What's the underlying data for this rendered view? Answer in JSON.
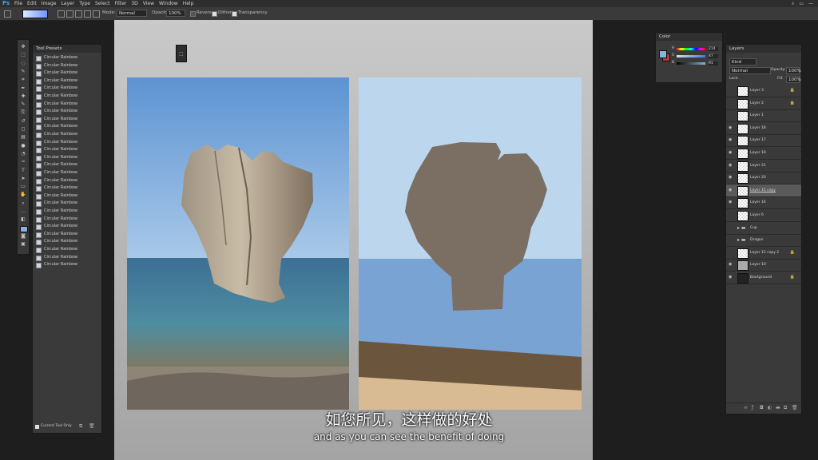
{
  "app": {
    "logo": "Ps"
  },
  "menu": [
    "File",
    "Edit",
    "Image",
    "Layer",
    "Type",
    "Select",
    "Filter",
    "3D",
    "View",
    "Window",
    "Help"
  ],
  "options": {
    "mode_label": "Mode:",
    "mode_value": "Normal",
    "opacity_label": "Opacity:",
    "opacity_value": "100%",
    "reverse_label": "Reverse",
    "dither_label": "Dither",
    "transparency_label": "Transparency"
  },
  "tool_presets": {
    "title": "Tool Presets",
    "items": [
      "Circular Rainbow",
      "Circular Rainbow",
      "Circular Rainbow",
      "Circular Rainbow",
      "Circular Rainbow",
      "Circular Rainbow",
      "Circular Rainbow",
      "Circular Rainbow",
      "Circular Rainbow",
      "Circular Rainbow",
      "Circular Rainbow",
      "Circular Rainbow",
      "Circular Rainbow",
      "Circular Rainbow",
      "Circular Rainbow",
      "Circular Rainbow",
      "Circular Rainbow",
      "Circular Rainbow",
      "Circular Rainbow",
      "Circular Rainbow",
      "Circular Rainbow",
      "Circular Rainbow",
      "Circular Rainbow",
      "Circular Rainbow",
      "Circular Rainbow",
      "Circular Rainbow",
      "Circular Rainbow",
      "Circular Rainbow"
    ],
    "current_tool_only": "Current Tool Only"
  },
  "color_panel": {
    "title": "Color",
    "channels": [
      {
        "label": "H",
        "value": "214"
      },
      {
        "label": "S",
        "value": "47"
      },
      {
        "label": "B",
        "value": "91"
      }
    ],
    "foreground": "#8ab0de",
    "background": "#b23b30"
  },
  "layers_panel": {
    "title": "Layers",
    "kind_label": "Kind",
    "blend_mode": "Normal",
    "opacity_label": "Opacity:",
    "opacity_value": "100%",
    "lock_label": "Lock:",
    "fill_label": "Fill:",
    "fill_value": "100%",
    "layers": [
      {
        "name": "Layer 3",
        "visible": false,
        "locked": true
      },
      {
        "name": "Layer 2",
        "visible": false,
        "locked": true
      },
      {
        "name": "Layer 1",
        "visible": false,
        "locked": false
      },
      {
        "name": "Layer 18",
        "visible": true,
        "locked": false
      },
      {
        "name": "Layer 17",
        "visible": true,
        "locked": false
      },
      {
        "name": "Layer 19",
        "visible": true,
        "locked": false
      },
      {
        "name": "Layer 21",
        "visible": true,
        "locked": false
      },
      {
        "name": "Layer 20",
        "visible": true,
        "locked": false
      },
      {
        "name": "Layer 15 copy",
        "visible": true,
        "locked": false,
        "selected": true
      },
      {
        "name": "Layer 16",
        "visible": true,
        "locked": false
      },
      {
        "name": "Layer 6",
        "visible": false,
        "locked": false
      },
      {
        "name": "Cup",
        "visible": false,
        "locked": false,
        "group": true
      },
      {
        "name": "Dragon",
        "visible": false,
        "locked": false,
        "group": true
      },
      {
        "name": "Layer 12 copy 2",
        "visible": false,
        "locked": true
      },
      {
        "name": "Layer 10",
        "visible": true,
        "locked": false
      },
      {
        "name": "Background",
        "visible": true,
        "locked": true
      }
    ]
  },
  "subtitles": {
    "chinese": "如您所见，这样做的好处",
    "english": "and as you can see the benefit of doing"
  },
  "colors": {
    "sky_photo": "#6f9fd6",
    "paint_sky": "#bcd6ee",
    "paint_sea": "#78a3d2",
    "rock_paint": "#7b6e62",
    "paint_dark_band": "#6b553d",
    "paint_sand": "#d8bb93"
  }
}
